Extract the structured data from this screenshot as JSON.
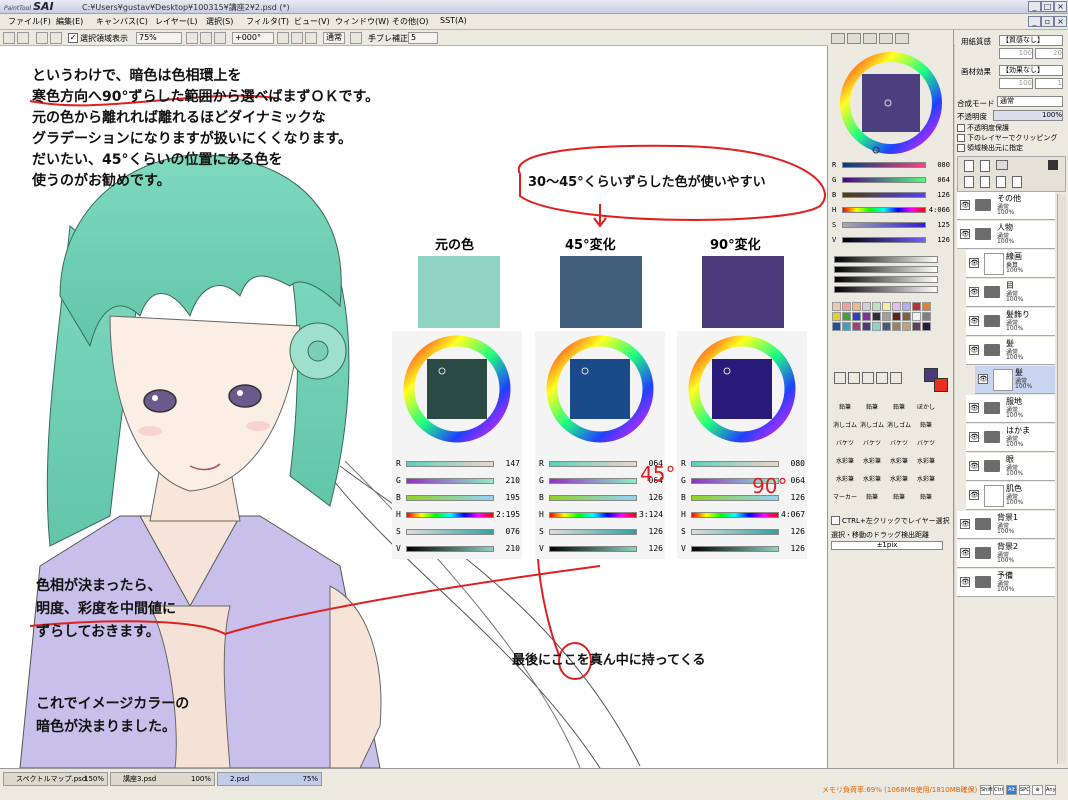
{
  "window": {
    "app_logo": "SAI",
    "app_logo_small": "PaintTool",
    "title": "C:¥Users¥gustav¥Desktop¥100315¥講座2¥2.psd (*)",
    "minimize": "_",
    "maximize": "□",
    "close": "×"
  },
  "menu": [
    "ファイル(F)",
    "編集(E)",
    "キャンバス(C)",
    "レイヤー(L)",
    "選択(S)",
    "フィルタ(T)",
    "ビュー(V)",
    "ウィンドウ(W)",
    "その他(O)",
    "SST(A)"
  ],
  "toolbar": {
    "selection_display": "選択領域表示",
    "zoom": "75%",
    "rotation": "+000°",
    "blend": "通常",
    "stabilizer_label": "手ブレ補正",
    "stabilizer_value": "5"
  },
  "canvas": {
    "note_top": [
      "というわけで、暗色は色相環上を",
      "寒色方向へ90°ずらした範囲から選べばまずＯＫです。",
      "元の色から離れれば離れるほどダイナミックな",
      "グラデーションになりますが扱いにくくなります。",
      "だいたい、45°くらいの位置にある色を",
      "使うのがお勧めです。"
    ],
    "bubble": "30〜45°くらいずらした色が使いやすい",
    "col_labels": [
      "元の色",
      "45°変化",
      "90°変化"
    ],
    "swatch_colors": [
      "#8fd3c3",
      "#3f5f7a",
      "#4a3a7a"
    ],
    "panels": [
      {
        "R": "147",
        "G": "210",
        "B": "195",
        "H": "2:195",
        "S": "076",
        "V": "210"
      },
      {
        "R": "064",
        "G": "064",
        "B": "126",
        "H": "3:124",
        "S": "126",
        "V": "126"
      },
      {
        "R": "080",
        "G": "064",
        "B": "126",
        "H": "4:067",
        "S": "126",
        "V": "126"
      }
    ],
    "handwritten_45": "45°",
    "handwritten_90": "90°",
    "note_mid": [
      "色相が決まったら、",
      "明度、彩度を中間値に",
      "ずらしておきます。"
    ],
    "note_bottom": [
      "これでイメージカラーの",
      "暗色が決まりました。"
    ],
    "note_center": "最後にここを真ん中に持ってくる"
  },
  "color_panel": {
    "R": "080",
    "G": "064",
    "B": "126",
    "H": "4:066",
    "S": "125",
    "V": "126",
    "tools": [
      "鉛筆",
      "鉛筆",
      "鉛筆",
      "ぼかし",
      "消しゴム",
      "消しゴム",
      "消しゴム",
      "鉛筆",
      "バケツ",
      "バケツ",
      "バケツ",
      "バケツ",
      "水彩筆",
      "水彩筆",
      "水彩筆",
      "水彩筆",
      "水彩筆",
      "水彩筆",
      "水彩筆",
      "水彩筆",
      "マーカー",
      "鉛筆",
      "鉛筆",
      "鉛筆"
    ],
    "ctrl_label": "CTRL+左クリックでレイヤー選択",
    "drag_label": "選択・移動のドラッグ検出距離",
    "drag_value": "±1pix"
  },
  "layer_panel": {
    "paper_texture_label": "用紙質感",
    "paper_texture_value": "【質感なし】",
    "paper_values": [
      "100",
      "20"
    ],
    "brush_effect_label": "画材効果",
    "brush_effect_value": "【効果なし】",
    "brush_values": [
      "100",
      "1"
    ],
    "blend_label": "合成モード",
    "blend_value": "通常",
    "opacity_label": "不透明度",
    "opacity_value": "100%",
    "checks": [
      "不透明度保護",
      "下のレイヤーでクリッピング",
      "領域検出元に指定"
    ],
    "layers": [
      {
        "name": "その他",
        "mode": "通常",
        "op": "100%",
        "type": "folder",
        "indent": 0
      },
      {
        "name": "人物",
        "mode": "通常",
        "op": "100%",
        "type": "folder",
        "indent": 0
      },
      {
        "name": "線画",
        "mode": "乗算",
        "op": "100%",
        "type": "layer",
        "indent": 1
      },
      {
        "name": "目",
        "mode": "通常",
        "op": "100%",
        "type": "folder",
        "indent": 1
      },
      {
        "name": "髪飾り",
        "mode": "通常",
        "op": "100%",
        "type": "folder",
        "indent": 1
      },
      {
        "name": "髪",
        "mode": "通常",
        "op": "100%",
        "type": "folder",
        "indent": 1
      },
      {
        "name": "髪",
        "mode": "通常",
        "op": "100%",
        "type": "layer",
        "indent": 2
      },
      {
        "name": "服地",
        "mode": "通常",
        "op": "100%",
        "type": "folder",
        "indent": 1
      },
      {
        "name": "はかま",
        "mode": "通常",
        "op": "100%",
        "type": "folder",
        "indent": 1
      },
      {
        "name": "眼",
        "mode": "通常",
        "op": "100%",
        "type": "folder",
        "indent": 1
      },
      {
        "name": "肌色",
        "mode": "通常",
        "op": "100%",
        "type": "layer",
        "indent": 1
      },
      {
        "name": "背景1",
        "mode": "通常",
        "op": "100%",
        "type": "folder",
        "indent": 0
      },
      {
        "name": "背景2",
        "mode": "通常",
        "op": "100%",
        "type": "folder",
        "indent": 0
      },
      {
        "name": "予備",
        "mode": "通常",
        "op": "100%",
        "type": "folder",
        "indent": 0
      }
    ]
  },
  "status": {
    "tabs": [
      {
        "name": "スペクトルマップ.psd",
        "pct": "150%"
      },
      {
        "name": "講座3.psd",
        "pct": "100%"
      },
      {
        "name": "2.psd",
        "pct": "75%"
      }
    ],
    "memory": "メモリ負荷率:69% (1068MB使用/1810MB確保)",
    "keys": [
      "Shift",
      "Ctrl",
      "Alt",
      "SPC",
      "⊕",
      "Any"
    ]
  }
}
